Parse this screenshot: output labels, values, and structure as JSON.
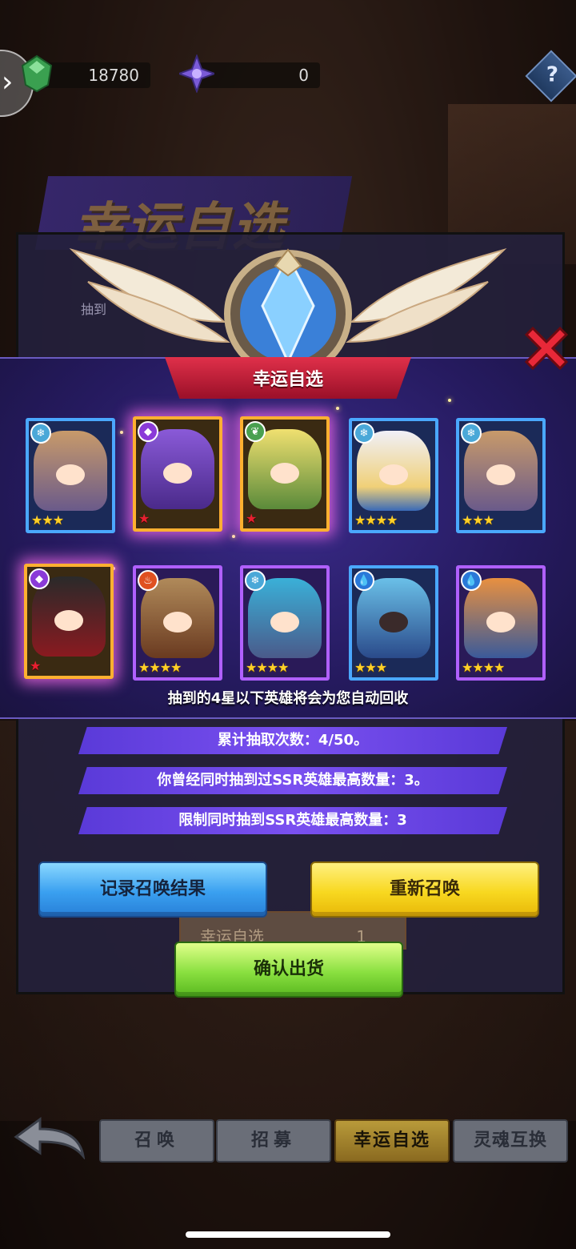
{
  "resources": {
    "coins": "18780",
    "crystals": "0"
  },
  "background": {
    "title": "幸运自选",
    "subtitle": "抽到",
    "tag_label": "幸运自选",
    "tag_count": "1"
  },
  "popup": {
    "title": "幸运自选",
    "heroes": [
      {
        "element": "ice",
        "rarity": "3",
        "star_type": "gold",
        "frame": "blue"
      },
      {
        "element": "dark",
        "rarity": "1",
        "star_type": "red",
        "frame": "gold"
      },
      {
        "element": "nature",
        "rarity": "1",
        "star_type": "red",
        "frame": "gold"
      },
      {
        "element": "ice",
        "rarity": "4",
        "star_type": "gold",
        "frame": "blue"
      },
      {
        "element": "ice",
        "rarity": "3",
        "star_type": "gold",
        "frame": "blue"
      },
      {
        "element": "dark",
        "rarity": "1",
        "star_type": "red",
        "frame": "gold"
      },
      {
        "element": "fire",
        "rarity": "4",
        "star_type": "gold",
        "frame": "purple"
      },
      {
        "element": "ice",
        "rarity": "4",
        "star_type": "gold",
        "frame": "purple"
      },
      {
        "element": "water",
        "rarity": "3",
        "star_type": "gold",
        "frame": "blue"
      },
      {
        "element": "water",
        "rarity": "4",
        "star_type": "gold",
        "frame": "purple"
      }
    ],
    "notice": "抽到的4星以下英雄将会为您自动回收"
  },
  "stats": {
    "total_draws": "累计抽取次数：4/50。",
    "max_ssr_history": "你曾经同时抽到过SSR英雄最高数量：3。",
    "ssr_limit": "限制同时抽到SSR英雄最高数量：3"
  },
  "buttons": {
    "record": "记录召唤结果",
    "resummon": "重新召唤",
    "confirm": "确认出货"
  },
  "tabs": [
    {
      "label": "召唤",
      "active": false
    },
    {
      "label": "招募",
      "active": false
    },
    {
      "label": "幸运自选",
      "active": true
    },
    {
      "label": "灵魂互换",
      "active": false
    }
  ],
  "icons": {
    "ice": "❄",
    "dark": "◆",
    "nature": "❦",
    "fire": "♨",
    "water": "💧",
    "star": "★"
  },
  "colors": {
    "popup_bg": "#251a5e",
    "ribbon": "#d0203e",
    "gold_star": "#ffd028",
    "red_star": "#e82030"
  }
}
